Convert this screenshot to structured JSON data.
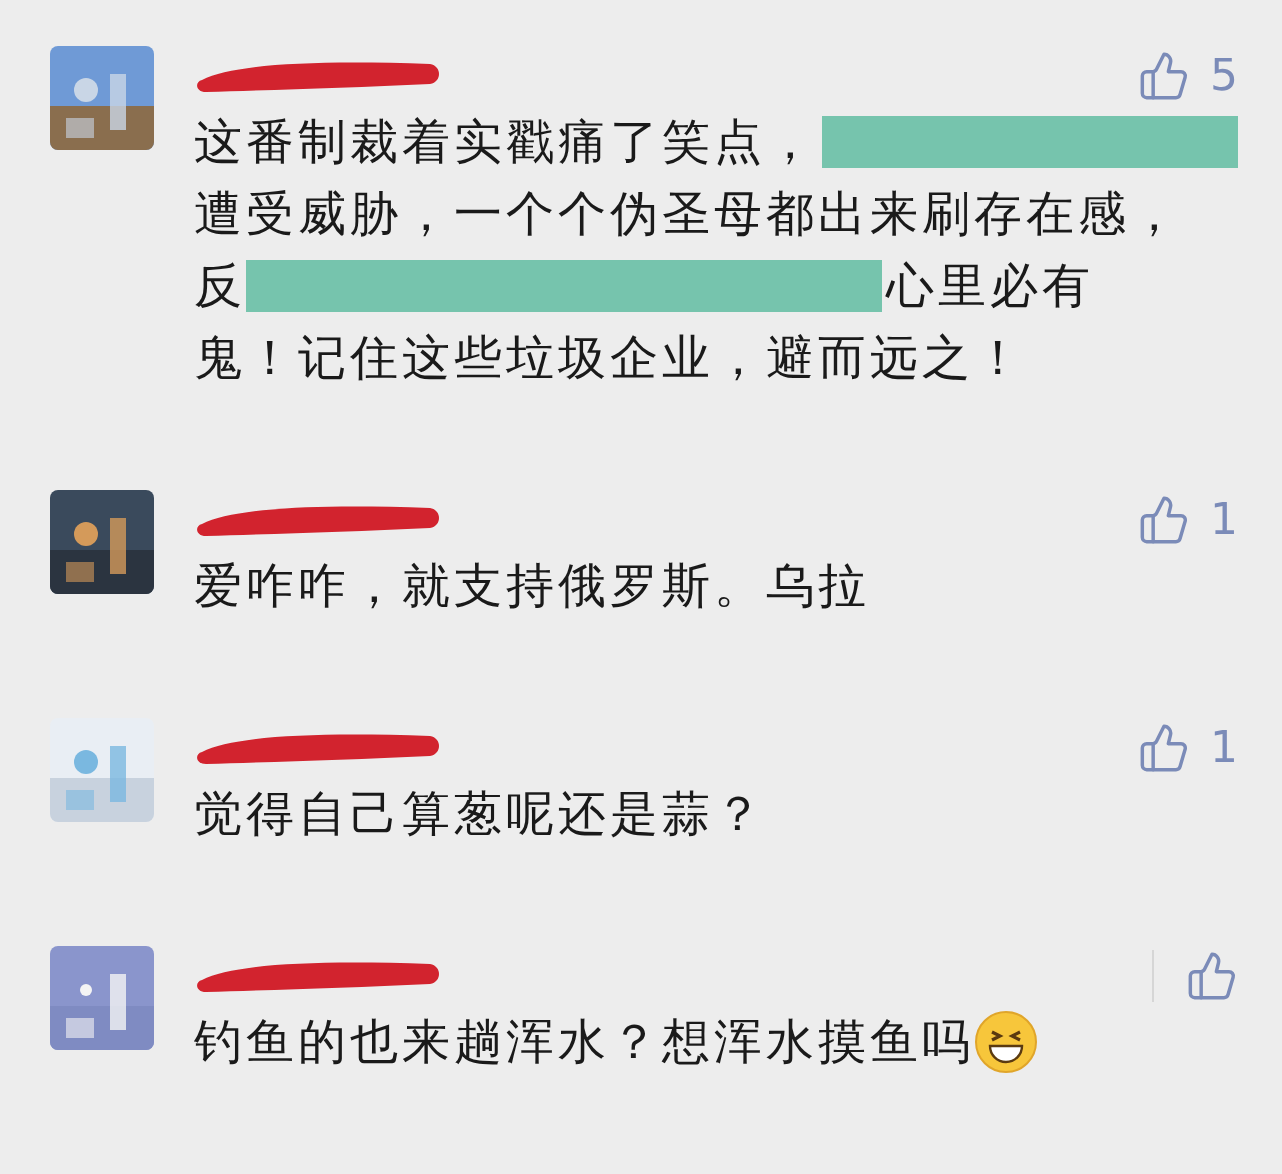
{
  "comments": [
    {
      "avatar": {
        "kind": "picture"
      },
      "likes": "5",
      "lines": [
        [
          {
            "kind": "text",
            "text": "这番制裁着实戳痛了笑点，"
          },
          {
            "kind": "redacted"
          }
        ],
        [
          {
            "kind": "text",
            "text": "遭受威胁，一个个伪圣母都出来刷存在感，"
          }
        ],
        [
          {
            "kind": "text",
            "text": "反"
          },
          {
            "kind": "redacted"
          },
          {
            "kind": "text",
            "text": "心里必有"
          }
        ],
        [
          {
            "kind": "text",
            "text": "鬼！记住这些垃圾企业，避而远之！"
          }
        ]
      ]
    },
    {
      "avatar": {
        "kind": "picture"
      },
      "likes": "1",
      "lines": [
        [
          {
            "kind": "text",
            "text": "爱咋咋，就支持俄罗斯。乌拉"
          }
        ]
      ]
    },
    {
      "avatar": {
        "kind": "picture"
      },
      "likes": "1",
      "lines": [
        [
          {
            "kind": "text",
            "text": "觉得自己算葱呢还是蒜？"
          }
        ]
      ]
    },
    {
      "avatar": {
        "kind": "picture"
      },
      "lines": [
        [
          {
            "kind": "text",
            "text": "钓鱼的也来趟浑水？想浑水摸鱼吗"
          },
          {
            "kind": "emoji"
          }
        ]
      ]
    }
  ]
}
